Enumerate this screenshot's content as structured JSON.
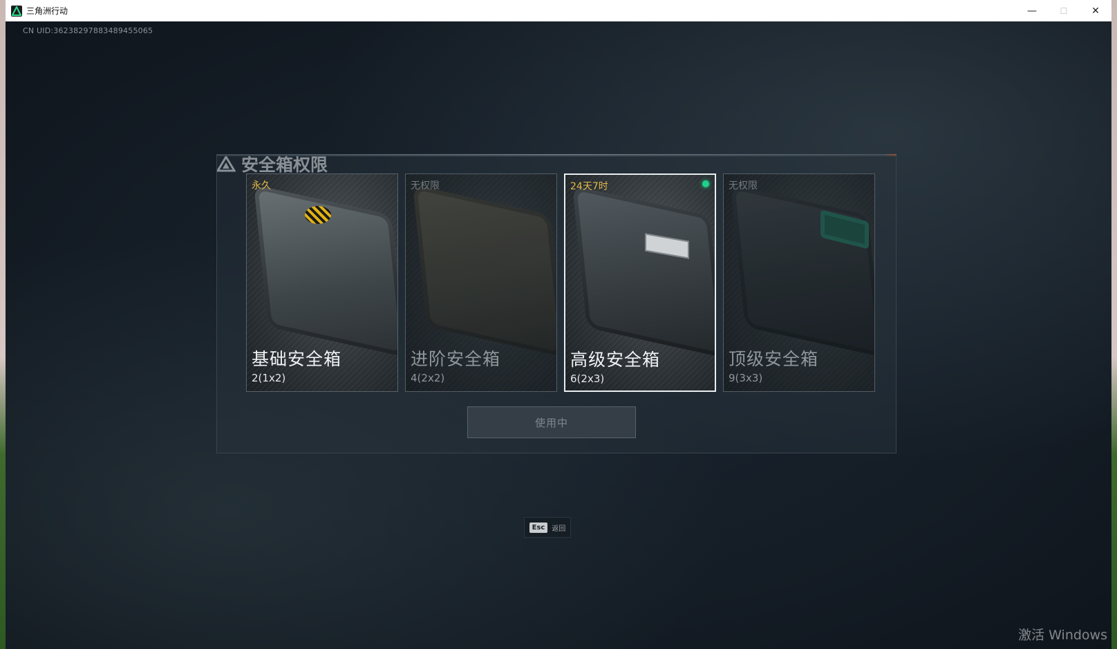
{
  "window": {
    "title": "三角洲行动",
    "controls": {
      "minimize": "—",
      "maximize": "☐",
      "close": "✕"
    }
  },
  "uid": "CN UID:36238297883489455065",
  "panel": {
    "title": "安全箱权限",
    "cards": [
      {
        "status": "永久",
        "name": "基础安全箱",
        "size": "2(1x2)",
        "state": "owned"
      },
      {
        "status": "无权限",
        "name": "进阶安全箱",
        "size": "4(2x2)",
        "state": "locked"
      },
      {
        "status": "24天7时",
        "name": "高级安全箱",
        "size": "6(2x3)",
        "state": "active"
      },
      {
        "status": "无权限",
        "name": "顶级安全箱",
        "size": "9(3x3)",
        "state": "locked"
      }
    ],
    "use_button": "使用中"
  },
  "esc_hint": {
    "key": "Esc",
    "label": "返回"
  },
  "watermark": "激活 Windows",
  "colors": {
    "accent_gold": "#e3b94a",
    "active_dot": "#1fd08a",
    "panel_bg": "#141b24"
  }
}
